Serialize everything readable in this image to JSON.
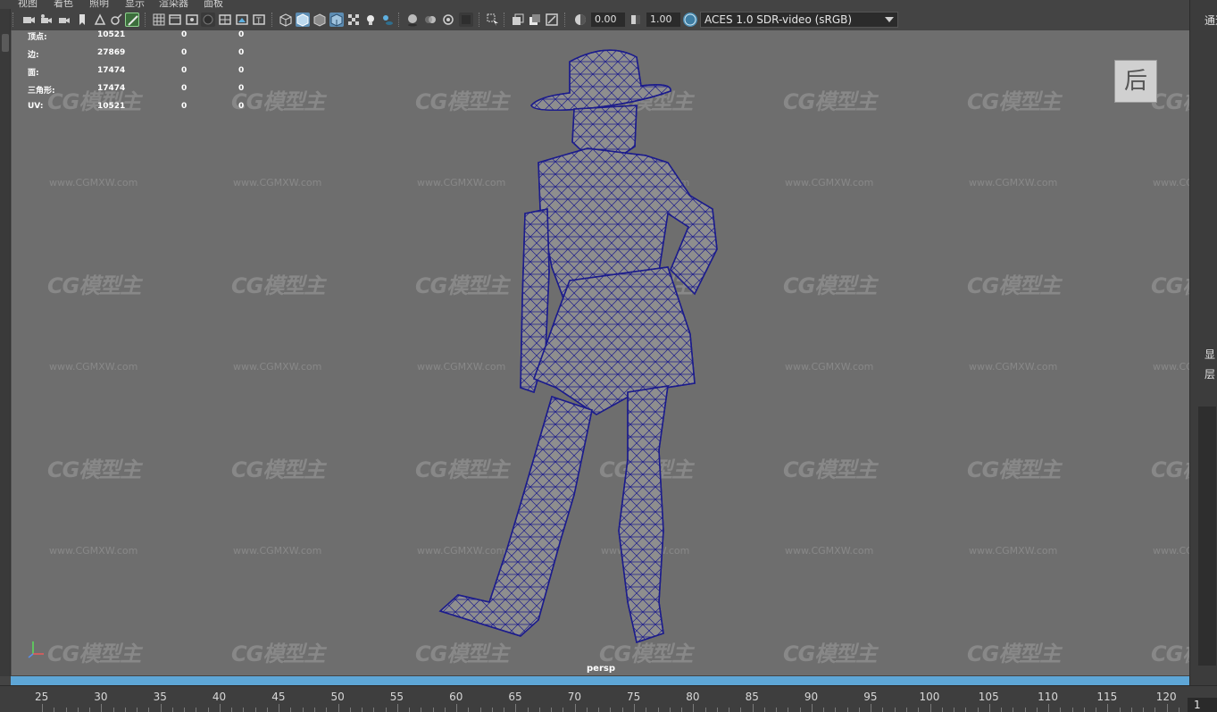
{
  "menu": {
    "items": [
      "视图",
      "着色",
      "照明",
      "显示",
      "渲染器",
      "面板"
    ]
  },
  "toolbar": {
    "exposure_value": "0.00",
    "gamma_value": "1.00",
    "color_management": "ACES 1.0 SDR-video (sRGB)",
    "icons": [
      "select-camera",
      "camera-attributes",
      "bookmark",
      "image-plane",
      "grease-pencil",
      "grid",
      "film-gate",
      "resolution-gate",
      "gate-mask",
      "field-chart",
      "safe-action",
      "safe-title",
      "wireframe",
      "smooth-shade",
      "wireframe-on-shaded",
      "textured",
      "use-all-lights",
      "shadows",
      "screen-space-ao",
      "motion-blur",
      "anti-aliasing",
      "depth-of-field",
      "isolate-select",
      "xray",
      "xray-joints",
      "xray-components",
      "exposure",
      "gamma",
      "color-management"
    ],
    "accent_color": "#5d8db3"
  },
  "hud": {
    "rows": [
      {
        "label": "顶点:",
        "v1": "10521",
        "v2": "0",
        "v3": "0"
      },
      {
        "label": "边:",
        "v1": "27869",
        "v2": "0",
        "v3": "0"
      },
      {
        "label": "面:",
        "v1": "17474",
        "v2": "0",
        "v3": "0"
      },
      {
        "label": "三角形:",
        "v1": "17474",
        "v2": "0",
        "v3": "0"
      },
      {
        "label": "UV:",
        "v1": "10521",
        "v2": "0",
        "v3": "0"
      }
    ]
  },
  "viewcube": {
    "face": "后"
  },
  "viewport": {
    "camera": "persp",
    "wireframe_color": "#1c1c8c",
    "model_color": "#8e8e8e"
  },
  "watermark": {
    "logo": "CG模型主",
    "url": "www.CGMXW.com"
  },
  "right_panel": {
    "top_text": "通道",
    "side_text_1": "显",
    "side_text_2": "层"
  },
  "timeline": {
    "ticks": [
      "25",
      "30",
      "35",
      "40",
      "45",
      "50",
      "55",
      "60",
      "65",
      "70",
      "75",
      "80",
      "85",
      "90",
      "95",
      "100",
      "105",
      "110",
      "115",
      "120"
    ],
    "current_frame": "1",
    "bar_color": "#5ea6d6"
  }
}
